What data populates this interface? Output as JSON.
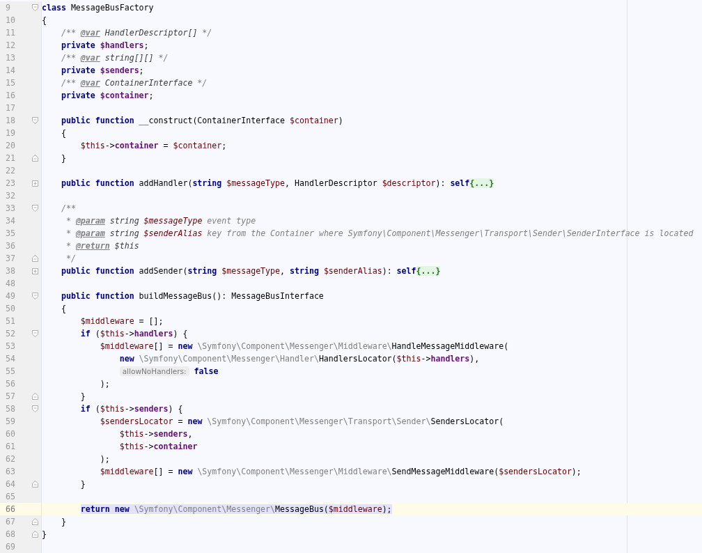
{
  "editor": {
    "lines": [
      {
        "number": "9",
        "kind": "fold_start",
        "current": false,
        "selected": false,
        "tokens": [
          {
            "kind": "kw",
            "text": "class"
          },
          {
            "kind": "plain",
            "text": " MessageBusFactory"
          }
        ]
      },
      {
        "number": "10",
        "kind": "plain",
        "current": false,
        "selected": false,
        "tokens": [
          {
            "kind": "plain",
            "text": "{"
          }
        ]
      },
      {
        "number": "11",
        "kind": "plain",
        "current": false,
        "selected": false,
        "tokens": [
          {
            "kind": "comment",
            "text": "    /** "
          },
          {
            "kind": "doctag",
            "text": "@var"
          },
          {
            "kind": "doctype",
            "text": " HandlerDescriptor[]"
          },
          {
            "kind": "comment",
            "text": " */"
          }
        ]
      },
      {
        "number": "12",
        "kind": "plain",
        "current": false,
        "selected": false,
        "tokens": [
          {
            "kind": "kw",
            "text": "    private "
          },
          {
            "kind": "field",
            "text": "$handlers"
          },
          {
            "kind": "plain",
            "text": ";"
          }
        ]
      },
      {
        "number": "13",
        "kind": "plain",
        "current": false,
        "selected": false,
        "tokens": [
          {
            "kind": "comment",
            "text": "    /** "
          },
          {
            "kind": "doctag",
            "text": "@var"
          },
          {
            "kind": "doctype",
            "text": " string[][]"
          },
          {
            "kind": "comment",
            "text": " */"
          }
        ]
      },
      {
        "number": "14",
        "kind": "plain",
        "current": false,
        "selected": false,
        "tokens": [
          {
            "kind": "kw",
            "text": "    private "
          },
          {
            "kind": "field",
            "text": "$senders"
          },
          {
            "kind": "plain",
            "text": ";"
          }
        ]
      },
      {
        "number": "15",
        "kind": "plain",
        "current": false,
        "selected": false,
        "tokens": [
          {
            "kind": "comment",
            "text": "    /** "
          },
          {
            "kind": "doctag",
            "text": "@var"
          },
          {
            "kind": "doctype",
            "text": " ContainerInterface"
          },
          {
            "kind": "comment",
            "text": " */"
          }
        ]
      },
      {
        "number": "16",
        "kind": "plain",
        "current": false,
        "selected": false,
        "tokens": [
          {
            "kind": "kw",
            "text": "    private "
          },
          {
            "kind": "field",
            "text": "$container"
          },
          {
            "kind": "plain",
            "text": ";"
          }
        ]
      },
      {
        "number": "17",
        "kind": "plain",
        "current": false
      },
      {
        "number": "18",
        "kind": "fold_start",
        "current": false,
        "selected": false,
        "tokens": [
          {
            "kind": "kw",
            "text": "    public function"
          },
          {
            "kind": "plain",
            "text": " __construct(ContainerInterface "
          },
          {
            "kind": "var",
            "text": "$container"
          },
          {
            "kind": "plain",
            "text": ")"
          }
        ]
      },
      {
        "number": "19",
        "kind": "plain",
        "current": false,
        "selected": false,
        "tokens": [
          {
            "kind": "plain",
            "text": "    {"
          }
        ]
      },
      {
        "number": "20",
        "kind": "plain",
        "current": false,
        "selected": false,
        "tokens": [
          {
            "kind": "var",
            "text": "        $this"
          },
          {
            "kind": "plain",
            "text": "->"
          },
          {
            "kind": "field",
            "text": "container"
          },
          {
            "kind": "plain",
            "text": " = "
          },
          {
            "kind": "var",
            "text": "$container"
          },
          {
            "kind": "plain",
            "text": ";"
          }
        ]
      },
      {
        "number": "21",
        "kind": "fold_end",
        "current": false,
        "selected": false,
        "tokens": [
          {
            "kind": "plain",
            "text": "    }"
          }
        ]
      },
      {
        "number": "22",
        "kind": "plain",
        "current": false
      },
      {
        "number": "23",
        "kind": "folded",
        "current": false,
        "selected": false,
        "tokens": [
          {
            "kind": "kw",
            "text": "    public function"
          },
          {
            "kind": "plain",
            "text": " addHandler("
          },
          {
            "kind": "kw",
            "text": "string"
          },
          {
            "kind": "var",
            "text": " $messageType"
          },
          {
            "kind": "plain",
            "text": ", HandlerDescriptor "
          },
          {
            "kind": "var",
            "text": "$descriptor"
          },
          {
            "kind": "plain",
            "text": "): "
          },
          {
            "kind": "kw",
            "text": "self"
          },
          {
            "kind": "folded",
            "text": "{...}"
          }
        ]
      },
      {
        "number": "32",
        "kind": "plain",
        "current": false
      },
      {
        "number": "33",
        "kind": "fold_start",
        "current": false,
        "selected": false,
        "tokens": [
          {
            "kind": "comment",
            "text": "    /**"
          }
        ]
      },
      {
        "number": "34",
        "kind": "plain",
        "current": false,
        "selected": false,
        "tokens": [
          {
            "kind": "comment",
            "text": "     * "
          },
          {
            "kind": "doctag",
            "text": "@param"
          },
          {
            "kind": "doctype",
            "text": " string "
          },
          {
            "kind": "docvar",
            "text": "$messageType"
          },
          {
            "kind": "comment",
            "text": " event type"
          }
        ]
      },
      {
        "number": "35",
        "kind": "plain",
        "current": false,
        "selected": false,
        "tokens": [
          {
            "kind": "comment",
            "text": "     * "
          },
          {
            "kind": "doctag",
            "text": "@param"
          },
          {
            "kind": "doctype",
            "text": " string "
          },
          {
            "kind": "docvar",
            "text": "$senderAlias"
          },
          {
            "kind": "comment",
            "text": " key from the Container where Symfony\\Component\\Messenger\\Transport\\Sender\\SenderInterface is located"
          }
        ]
      },
      {
        "number": "36",
        "kind": "plain",
        "current": false,
        "selected": false,
        "tokens": [
          {
            "kind": "comment",
            "text": "     * "
          },
          {
            "kind": "doctag",
            "text": "@return"
          },
          {
            "kind": "doctype",
            "text": " $this"
          }
        ]
      },
      {
        "number": "37",
        "kind": "fold_end",
        "current": false,
        "selected": false,
        "tokens": [
          {
            "kind": "comment",
            "text": "     */"
          }
        ]
      },
      {
        "number": "38",
        "kind": "folded",
        "current": false,
        "selected": false,
        "tokens": [
          {
            "kind": "kw",
            "text": "    public function"
          },
          {
            "kind": "plain",
            "text": " addSender("
          },
          {
            "kind": "kw",
            "text": "string"
          },
          {
            "kind": "var",
            "text": " $messageType"
          },
          {
            "kind": "plain",
            "text": ", "
          },
          {
            "kind": "kw",
            "text": "string"
          },
          {
            "kind": "var",
            "text": " $senderAlias"
          },
          {
            "kind": "plain",
            "text": "): "
          },
          {
            "kind": "kw",
            "text": "self"
          },
          {
            "kind": "folded",
            "text": "{...}"
          }
        ]
      },
      {
        "number": "48",
        "kind": "plain",
        "current": false
      },
      {
        "number": "49",
        "kind": "fold_start",
        "current": false,
        "selected": false,
        "tokens": [
          {
            "kind": "kw",
            "text": "    public function"
          },
          {
            "kind": "plain",
            "text": " buildMessageBus(): MessageBusInterface"
          }
        ]
      },
      {
        "number": "50",
        "kind": "plain",
        "current": false,
        "selected": false,
        "tokens": [
          {
            "kind": "plain",
            "text": "    {"
          }
        ]
      },
      {
        "number": "51",
        "kind": "plain",
        "current": false,
        "selected": false,
        "tokens": [
          {
            "kind": "var",
            "text": "        $middleware"
          },
          {
            "kind": "plain",
            "text": " = [];"
          }
        ]
      },
      {
        "number": "52",
        "kind": "fold_start",
        "current": false,
        "selected": false,
        "tokens": [
          {
            "kind": "kw",
            "text": "        if"
          },
          {
            "kind": "plain",
            "text": " ("
          },
          {
            "kind": "var",
            "text": "$this"
          },
          {
            "kind": "plain",
            "text": "->"
          },
          {
            "kind": "field",
            "text": "handlers"
          },
          {
            "kind": "plain",
            "text": ") {"
          }
        ]
      },
      {
        "number": "53",
        "kind": "plain",
        "current": false,
        "selected": false,
        "tokens": [
          {
            "kind": "var",
            "text": "            $middleware"
          },
          {
            "kind": "plain",
            "text": "[] = "
          },
          {
            "kind": "kw",
            "text": "new"
          },
          {
            "kind": "ns",
            "text": " \\Symfony\\Component\\Messenger\\Middleware\\"
          },
          {
            "kind": "plain",
            "text": "HandleMessageMiddleware("
          }
        ]
      },
      {
        "number": "54",
        "kind": "plain",
        "current": false,
        "selected": false,
        "tokens": [
          {
            "kind": "kw",
            "text": "                new"
          },
          {
            "kind": "ns",
            "text": " \\Symfony\\Component\\Messenger\\Handler\\"
          },
          {
            "kind": "plain",
            "text": "HandlersLocator("
          },
          {
            "kind": "var",
            "text": "$this"
          },
          {
            "kind": "plain",
            "text": "->"
          },
          {
            "kind": "field",
            "text": "handlers"
          },
          {
            "kind": "plain",
            "text": "),"
          }
        ]
      },
      {
        "number": "55",
        "kind": "plain",
        "current": false,
        "selected": false,
        "tokens": [
          {
            "kind": "hint",
            "text": "                allowNoHandlers:"
          },
          {
            "kind": "kw",
            "text": " false"
          }
        ]
      },
      {
        "number": "56",
        "kind": "plain",
        "current": false,
        "selected": false,
        "tokens": [
          {
            "kind": "plain",
            "text": "            );"
          }
        ]
      },
      {
        "number": "57",
        "kind": "fold_end",
        "current": false,
        "selected": false,
        "tokens": [
          {
            "kind": "plain",
            "text": "        }"
          }
        ]
      },
      {
        "number": "58",
        "kind": "fold_start",
        "current": false,
        "selected": false,
        "tokens": [
          {
            "kind": "kw",
            "text": "        if"
          },
          {
            "kind": "plain",
            "text": " ("
          },
          {
            "kind": "var",
            "text": "$this"
          },
          {
            "kind": "plain",
            "text": "->"
          },
          {
            "kind": "field",
            "text": "senders"
          },
          {
            "kind": "plain",
            "text": ") {"
          }
        ]
      },
      {
        "number": "59",
        "kind": "plain",
        "current": false,
        "selected": false,
        "tokens": [
          {
            "kind": "var",
            "text": "            $sendersLocator"
          },
          {
            "kind": "plain",
            "text": " = "
          },
          {
            "kind": "kw",
            "text": "new"
          },
          {
            "kind": "ns",
            "text": " \\Symfony\\Component\\Messenger\\Transport\\Sender\\"
          },
          {
            "kind": "plain",
            "text": "SendersLocator("
          }
        ]
      },
      {
        "number": "60",
        "kind": "plain",
        "current": false,
        "selected": false,
        "tokens": [
          {
            "kind": "var",
            "text": "                $this"
          },
          {
            "kind": "plain",
            "text": "->"
          },
          {
            "kind": "field",
            "text": "senders"
          },
          {
            "kind": "plain",
            "text": ","
          }
        ]
      },
      {
        "number": "61",
        "kind": "plain",
        "current": false,
        "selected": false,
        "tokens": [
          {
            "kind": "var",
            "text": "                $this"
          },
          {
            "kind": "plain",
            "text": "->"
          },
          {
            "kind": "field",
            "text": "container"
          }
        ]
      },
      {
        "number": "62",
        "kind": "plain",
        "current": false,
        "selected": false,
        "tokens": [
          {
            "kind": "plain",
            "text": "            );"
          }
        ]
      },
      {
        "number": "63",
        "kind": "plain",
        "current": false,
        "selected": false,
        "tokens": [
          {
            "kind": "var",
            "text": "            $middleware"
          },
          {
            "kind": "plain",
            "text": "[] = "
          },
          {
            "kind": "kw",
            "text": "new"
          },
          {
            "kind": "ns",
            "text": " \\Symfony\\Component\\Messenger\\Middleware\\"
          },
          {
            "kind": "plain",
            "text": "SendMessageMiddleware("
          },
          {
            "kind": "var",
            "text": "$sendersLocator"
          },
          {
            "kind": "plain",
            "text": ");"
          }
        ]
      },
      {
        "number": "64",
        "kind": "fold_end",
        "current": false,
        "selected": false,
        "tokens": [
          {
            "kind": "plain",
            "text": "        }"
          }
        ]
      },
      {
        "number": "65",
        "kind": "plain",
        "current": false
      },
      {
        "number": "66",
        "kind": "plain",
        "current": true,
        "selected": true,
        "tokens": [
          {
            "kind": "kw",
            "text": "        return new"
          },
          {
            "kind": "ns",
            "text": " \\Symfony\\Component\\Messenger\\"
          },
          {
            "kind": "plain",
            "text": "MessageBus("
          },
          {
            "kind": "var",
            "text": "$middleware"
          },
          {
            "kind": "plain",
            "text": ");"
          }
        ]
      },
      {
        "number": "67",
        "kind": "fold_end",
        "current": false,
        "selected": false,
        "tokens": [
          {
            "kind": "plain",
            "text": "    }"
          }
        ]
      },
      {
        "number": "68",
        "kind": "fold_end",
        "current": false,
        "selected": false,
        "tokens": [
          {
            "kind": "plain",
            "text": "}"
          }
        ]
      },
      {
        "number": "69",
        "kind": "plain",
        "current": false
      }
    ]
  }
}
